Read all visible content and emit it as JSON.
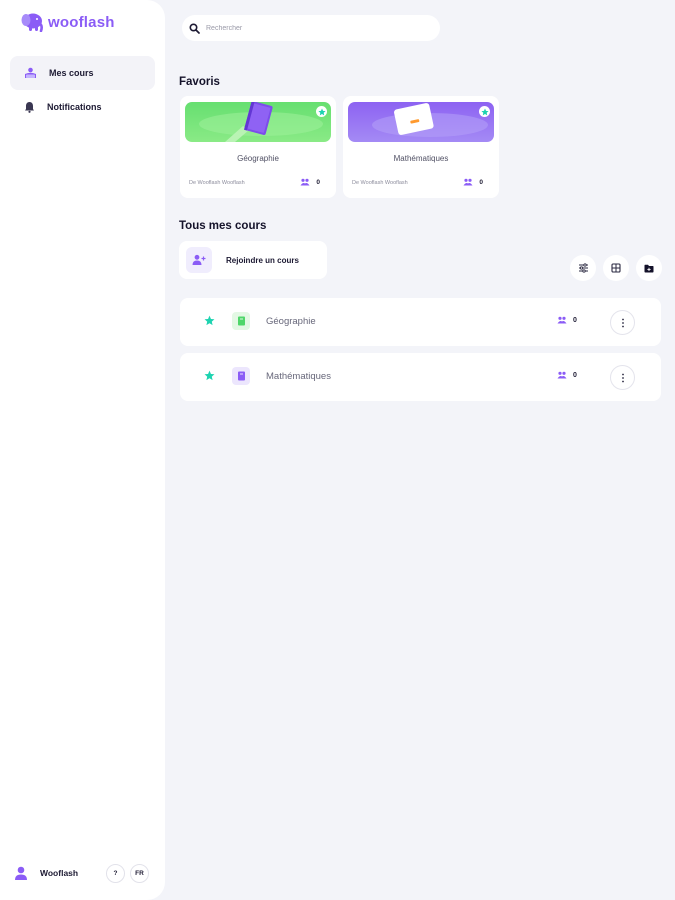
{
  "app": {
    "name": "wooflash"
  },
  "sidebar": {
    "items": [
      {
        "label": "Mes cours",
        "icon": "courses-icon",
        "active": true
      },
      {
        "label": "Notifications",
        "icon": "bell-icon",
        "active": false
      }
    ],
    "footer": {
      "user_name": "Wooflash",
      "help_label": "?",
      "lang_label": "FR"
    }
  },
  "search": {
    "placeholder": "Rechercher",
    "value": ""
  },
  "favorites": {
    "title": "Favoris",
    "cards": [
      {
        "name": "Géographie",
        "author": "De Wooflash Wooflash",
        "members": "0",
        "color": "green"
      },
      {
        "name": "Mathématiques",
        "author": "De Wooflash Wooflash",
        "members": "0",
        "color": "purple"
      }
    ]
  },
  "all_courses": {
    "title": "Tous mes cours",
    "join_label": "Rejoindre un cours",
    "rows": [
      {
        "name": "Géographie",
        "members": "0",
        "starred": true,
        "color": "green"
      },
      {
        "name": "Mathématiques",
        "members": "0",
        "starred": true,
        "color": "purple"
      }
    ]
  },
  "colors": {
    "accent": "#8b5cf6",
    "star": "#1dd3b0",
    "green": "#66df70",
    "background": "#f3f4f9"
  }
}
